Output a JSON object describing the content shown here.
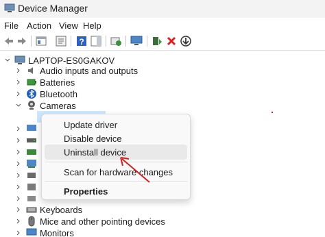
{
  "window": {
    "title": "Device Manager"
  },
  "menu": [
    "File",
    "Action",
    "View",
    "Help"
  ],
  "toolbar": [
    {
      "name": "back-arrow-icon"
    },
    {
      "name": "forward-arrow-icon"
    },
    {
      "name": "properties-icon"
    },
    {
      "name": "show-hide-console-icon"
    },
    {
      "name": "help-icon"
    },
    {
      "name": "action-pane-icon"
    },
    {
      "name": "scan-hardware-icon"
    },
    {
      "name": "monitor-icon"
    },
    {
      "name": "update-driver-icon"
    },
    {
      "name": "uninstall-x-icon"
    },
    {
      "name": "download-icon"
    }
  ],
  "tree": {
    "root": "LAPTOP-ES0GAKOV",
    "categories": {
      "audio": "Audio inputs and outputs",
      "batteries": "Batteries",
      "bluetooth": "Bluetooth",
      "cameras": "Cameras",
      "keyboards": "Keyboards",
      "mice": "Mice and other pointing devices",
      "monitors": "Monitors"
    }
  },
  "context_menu": {
    "update_driver": "Update driver",
    "disable_device": "Disable device",
    "uninstall_device": "Uninstall device",
    "scan_hardware": "Scan for hardware changes",
    "properties": "Properties"
  },
  "colors": {
    "selection": "#cce8ff",
    "accent_red": "#d02020",
    "menu_bg": "#f9f9f9"
  }
}
